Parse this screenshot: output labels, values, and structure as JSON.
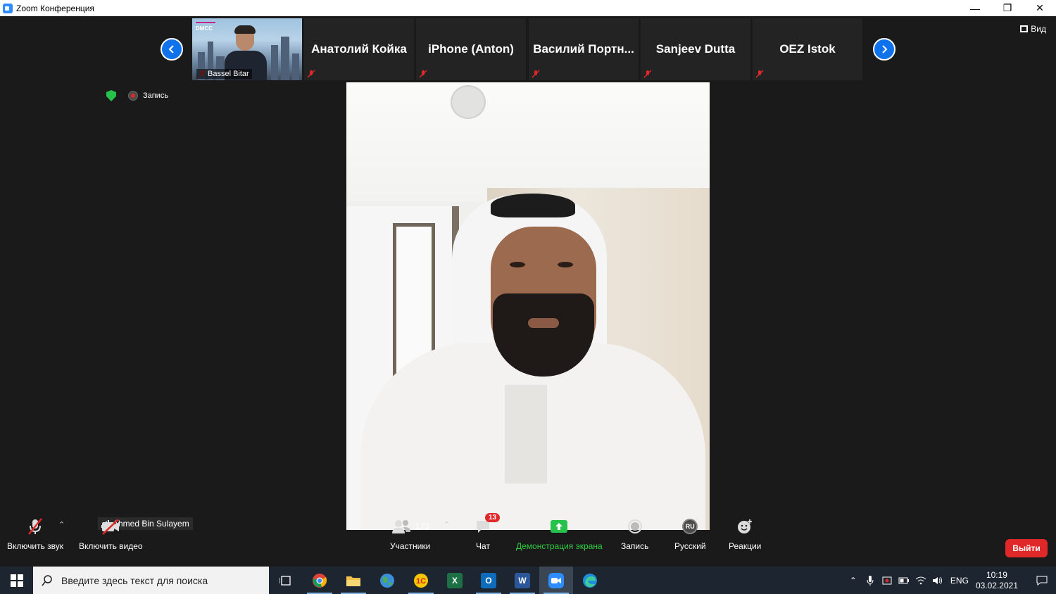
{
  "window": {
    "title": "Zoom Конференция"
  },
  "top_right": {
    "view_label": "Вид"
  },
  "participants_strip": {
    "video_tile": {
      "name": "Bassel Bitar",
      "banner": "DMCC"
    },
    "tiles": [
      {
        "name": "Анатолий Койка"
      },
      {
        "name": "iPhone (Anton)"
      },
      {
        "name": "Василий  Портн..."
      },
      {
        "name": "Sanjeev Dutta"
      },
      {
        "name": "OEZ Istok"
      }
    ]
  },
  "status": {
    "recording_label": "Запись"
  },
  "active_speaker": {
    "name": "Ahmed Bin Sulayem"
  },
  "toolbar": {
    "unmute_label": "Включить звук",
    "start_video_label": "Включить видео",
    "participants_label": "Участники",
    "participants_count": "173",
    "chat_label": "Чат",
    "chat_badge": "13",
    "share_label": "Демонстрация экрана",
    "record_label": "Запись",
    "language_label": "Русский",
    "language_code": "RU",
    "reactions_label": "Реакции",
    "leave_label": "Выйти"
  },
  "taskbar": {
    "search_placeholder": "Введите здесь текст для поиска",
    "lang": "ENG",
    "time": "10:19",
    "date": "03.02.2021",
    "apps": [
      "task-view",
      "chrome",
      "file-explorer",
      "maps",
      "1c",
      "excel",
      "outlook",
      "word",
      "zoom",
      "edge"
    ]
  },
  "colors": {
    "zoom_blue": "#0e72ed",
    "share_green": "#27c24c",
    "leave_red": "#e02828",
    "meeting_bg": "#1a1a1a",
    "taskbar_bg": "#1c2530"
  }
}
